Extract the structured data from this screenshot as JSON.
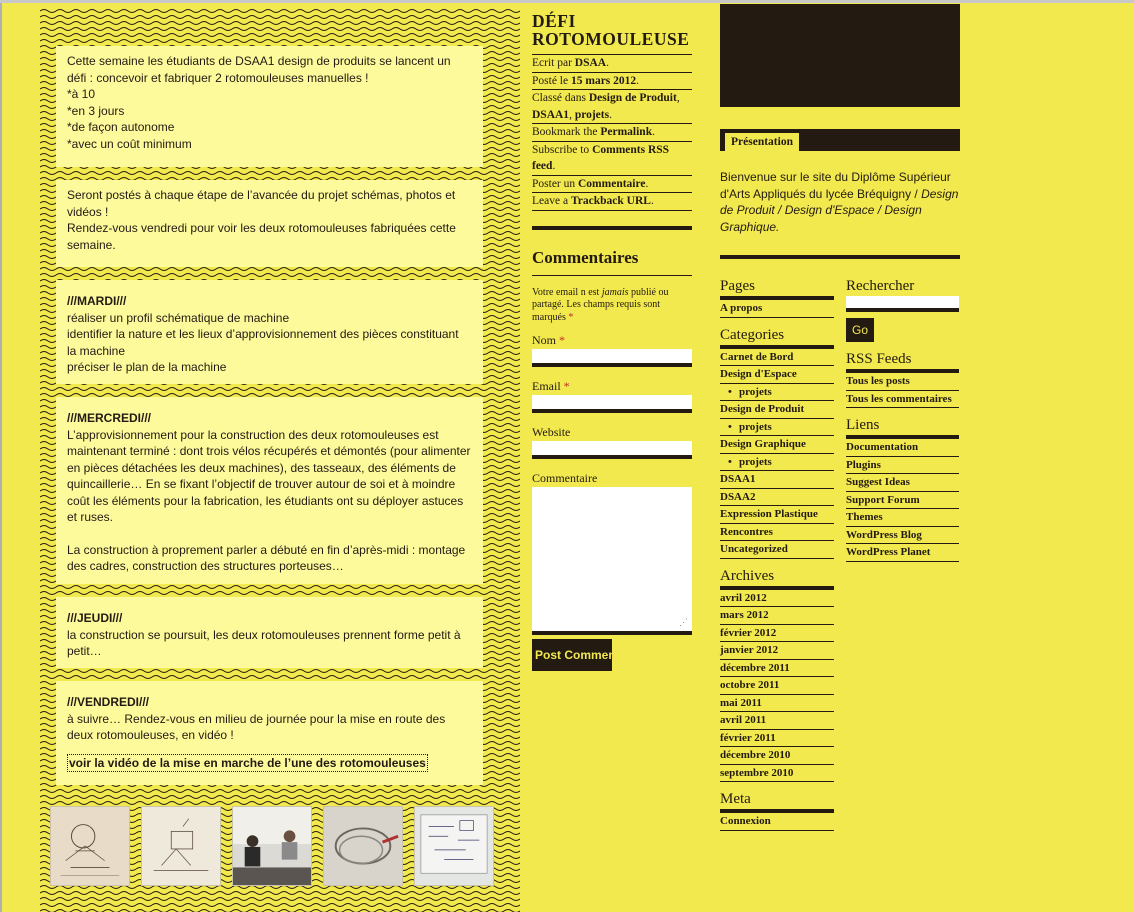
{
  "post": {
    "block1": {
      "line1": "Cette semaine les étudiants de DSAA1 design de produits se lancent un défi : concevoir et fabriquer 2 rotomouleuses manuelles !",
      "line2": "*à 10",
      "line3": "*en 3 jours",
      "line4": "*de façon autonome",
      "line5": "*avec un coût minimum"
    },
    "block2": {
      "line1": "Seront postés à chaque étape de l’avancée du projet schémas, photos et vidéos !",
      "line2": "Rendez-vous vendredi pour voir les deux rotomouleuses fabriquées cette semaine."
    },
    "block3": {
      "heading": "///MARDI///",
      "line1": "réaliser un profil schématique de machine",
      "line2": "identifier la nature et les lieux d’approvisionnement des pièces constituant la machine",
      "line3": "préciser le plan de la machine"
    },
    "block4": {
      "heading": "///MERCREDI///",
      "line1": "L’approvisionnement pour la construction des deux rotomouleuses est  maintenant terminé : dont trois vélos récupérés et démontés (pour alimenter en pièces détachées les deux machines), des tasseaux, des éléments de quincaillerie… En se fixant l’objectif de trouver autour de soi et à moindre coût les éléments pour la fabrication, les étudiants ont su déployer astuces et ruses.",
      "line2": "La construction à proprement parler a débuté en fin d’après-midi : montage des cadres, construction des structures porteuses…"
    },
    "block5": {
      "heading": "///JEUDI///",
      "line1": "la construction se poursuit, les deux rotomouleuses prennent forme petit à petit…"
    },
    "block6": {
      "heading": "///VENDREDI///",
      "line1": "à suivre… Rendez-vous en milieu de journée pour la mise en route des deux rotomouleuses, en vidéo !",
      "link": "voir la vidéo de la mise en marche de l’une des rotomouleuses"
    }
  },
  "meta": {
    "title": "DÉFI ROTOMOULEUSE",
    "author_prefix": "Ecrit par",
    "author": "DSAA",
    "date_prefix": "Posté le",
    "date": "15 mars 2012",
    "class_prefix": "Classé dans",
    "cat1": "Design de Produit",
    "cat2": "DSAA1",
    "cat3": "projets",
    "bookmark_prefix": "Bookmark the",
    "permalink": "Permalink",
    "subscribe_prefix": "Subscribe to",
    "rss": "Comments RSS feed",
    "comment_prefix": "Poster un",
    "comment_link": "Commentaire",
    "trackback_prefix": "Leave a",
    "trackback": "Trackback URL"
  },
  "comments": {
    "title": "Commentaires",
    "notice_a": "Votre email n est",
    "notice_em": "jamais",
    "notice_b": "publié ou partagé. Les champs requis sont marqués",
    "star": "*",
    "name_label": "Nom",
    "email_label": "Email",
    "website_label": "Website",
    "comment_label": "Commentaire",
    "submit": "Post Comment"
  },
  "presentation": {
    "tab": "Présentation",
    "text_a": "Bienvenue sur le site du Diplôme Supérieur d'Arts Appliqués du lycée Bréquigny /",
    "text_em": "Design de Produit / Design d'Espace / Design Graphique."
  },
  "sidebar": {
    "pages_title": "Pages",
    "pages": [
      "A propos"
    ],
    "categories_title": "Categories",
    "categories": [
      {
        "label": "Carnet de Bord",
        "sub": false
      },
      {
        "label": "Design d'Espace",
        "sub": false
      },
      {
        "label": "projets",
        "sub": true
      },
      {
        "label": "Design de Produit",
        "sub": false
      },
      {
        "label": "projets",
        "sub": true
      },
      {
        "label": "Design Graphique",
        "sub": false
      },
      {
        "label": "projets",
        "sub": true
      },
      {
        "label": "DSAA1",
        "sub": false
      },
      {
        "label": "DSAA2",
        "sub": false
      },
      {
        "label": "Expression Plastique",
        "sub": false
      },
      {
        "label": "Rencontres",
        "sub": false
      },
      {
        "label": "Uncategorized",
        "sub": false
      }
    ],
    "archives_title": "Archives",
    "archives": [
      "avril 2012",
      "mars 2012",
      "février 2012",
      "janvier 2012",
      "décembre 2011",
      "octobre 2011",
      "mai 2011",
      "avril 2011",
      "février 2011",
      "décembre 2010",
      "septembre 2010"
    ],
    "meta_title": "Meta",
    "meta_items": [
      "Connexion"
    ],
    "search_title": "Rechercher",
    "search_button": "Go",
    "rss_title": "RSS Feeds",
    "rss_items": [
      "Tous les posts",
      "Tous les commentaires"
    ],
    "links_title": "Liens",
    "links": [
      "Documentation",
      "Plugins",
      "Suggest Ideas",
      "Support Forum",
      "Themes",
      "WordPress Blog",
      "WordPress Planet"
    ]
  }
}
